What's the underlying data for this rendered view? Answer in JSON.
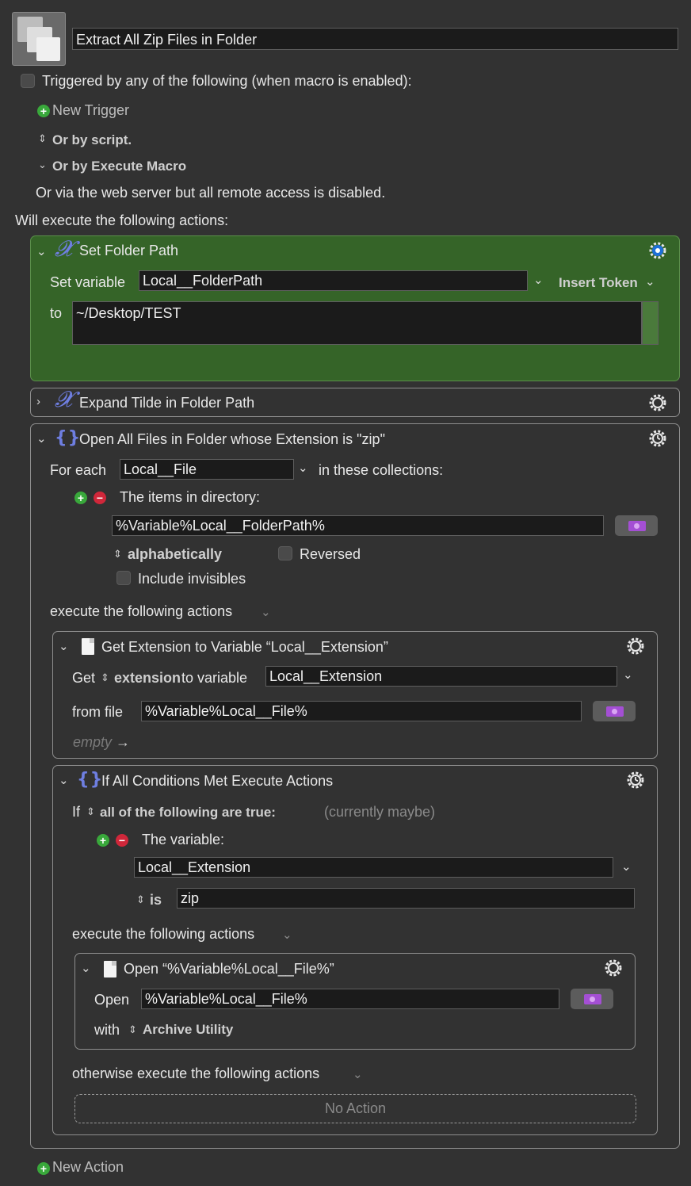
{
  "macro": {
    "name": "Extract All Zip Files in Folder",
    "trigger_label": "Triggered by any of the following (when macro is enabled):",
    "new_trigger": "New Trigger",
    "or_script": "Or by script.",
    "or_execute": "Or by Execute Macro",
    "web_server": "Or via the web server but all remote access is disabled.",
    "will_execute": "Will execute the following actions:",
    "new_action": "New Action"
  },
  "action1": {
    "title": "Set Folder Path",
    "set_variable_label": "Set variable",
    "variable": "Local__FolderPath",
    "insert_token": "Insert Token",
    "to_label": "to",
    "value": "~/Desktop/TEST"
  },
  "action2": {
    "title": "Expand Tilde in Folder Path"
  },
  "action3": {
    "title": "Open All Files in Folder whose Extension is \"zip\"",
    "for_each_label": "For each",
    "variable": "Local__File",
    "collections_label": "in these collections:",
    "items_label": "The items in directory:",
    "directory": "%Variable%Local__FolderPath%",
    "sort": "alphabetically",
    "reversed": "Reversed",
    "include_invisibles": "Include invisibles",
    "execute_label": "execute the following actions"
  },
  "action4": {
    "title": "Get Extension to Variable “Local__Extension”",
    "get_label": "Get",
    "attribute": "extension",
    "to_variable_label": "to variable",
    "variable": "Local__Extension",
    "from_file_label": "from file",
    "file": "%Variable%Local__File%",
    "empty_hint": "empty"
  },
  "action5": {
    "title": "If All Conditions Met Execute Actions",
    "if_label": "If",
    "condition_mode": "all of the following are true:",
    "status": "(currently maybe)",
    "the_variable_label": "The variable:",
    "variable": "Local__Extension",
    "operator": "is",
    "value": "zip",
    "execute_label": "execute the following actions",
    "otherwise_label": "otherwise execute the following actions",
    "no_action": "No Action"
  },
  "action6": {
    "title": "Open “%Variable%Local__File%”",
    "open_label": "Open",
    "file": "%Variable%Local__File%",
    "with_label": "with",
    "app": "Archive Utility"
  },
  "colors": {
    "background": "#323232",
    "green_panel": "#356428",
    "icon_blue": "#6e7ee0",
    "add_green": "#39a83b",
    "remove_red": "#d0273a",
    "token_purple": "#a44fd4"
  }
}
